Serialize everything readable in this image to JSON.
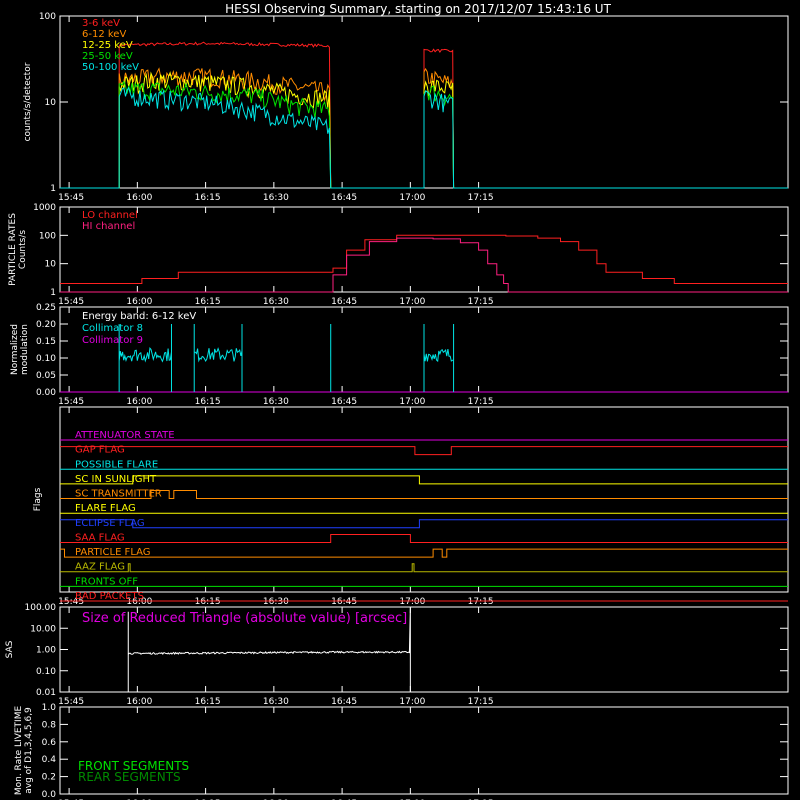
{
  "title": "HESSI Observing Summary, starting on 2017/12/07 15:43:16 UT",
  "time_axis": {
    "range_min": [
      -2,
      158
    ],
    "tick_labels": [
      "15:45",
      "16:00",
      "16:15",
      "16:30",
      "16:45",
      "17:00",
      "17:15"
    ],
    "tick_minutes": [
      0,
      15,
      30,
      45,
      60,
      75,
      90
    ]
  },
  "chart_data": [
    {
      "id": "counts",
      "type": "line",
      "ylabel": "counts/s/detector",
      "yscale": "log",
      "ylim": [
        1,
        100
      ],
      "yticks": [
        1,
        10,
        100
      ],
      "ytick_labels": [
        "1",
        "10",
        "100"
      ],
      "legend_placement": "top-left",
      "series": [
        {
          "name": "3-6 keV",
          "color": "#ff2020",
          "segments": [
            [
              [
                11,
                46
              ],
              [
                20,
                47
              ],
              [
                30,
                48
              ],
              [
                40,
                47
              ],
              [
                50,
                46
              ],
              [
                57.5,
                45
              ]
            ],
            [
              [
                78,
                40
              ],
              [
                84.5,
                39
              ]
            ]
          ]
        },
        {
          "name": "6-12 keV",
          "color": "#ff8c00",
          "segments": [
            [
              [
                11,
                18
              ],
              [
                20,
                20
              ],
              [
                30,
                20
              ],
              [
                40,
                18
              ],
              [
                50,
                15
              ],
              [
                57.5,
                13
              ]
            ],
            [
              [
                78,
                20
              ],
              [
                84.5,
                16
              ]
            ]
          ]
        },
        {
          "name": "12-25 keV",
          "color": "#ffff00",
          "segments": [
            [
              [
                11,
                16
              ],
              [
                20,
                18
              ],
              [
                30,
                17
              ],
              [
                40,
                15
              ],
              [
                50,
                12
              ],
              [
                57.5,
                11
              ]
            ],
            [
              [
                78,
                16
              ],
              [
                84.5,
                14
              ]
            ]
          ]
        },
        {
          "name": "25-50 keV",
          "color": "#00e000",
          "segments": [
            [
              [
                11,
                14
              ],
              [
                20,
                14
              ],
              [
                30,
                13
              ],
              [
                40,
                12
              ],
              [
                50,
                9
              ],
              [
                57.5,
                8
              ]
            ],
            [
              [
                78,
                14
              ],
              [
                84.5,
                11
              ]
            ]
          ]
        },
        {
          "name": "50-100 keV",
          "color": "#00e5e5",
          "segments": [
            [
              [
                11,
                12
              ],
              [
                20,
                11
              ],
              [
                30,
                10
              ],
              [
                40,
                8
              ],
              [
                50,
                6
              ],
              [
                57.5,
                5
              ]
            ],
            [
              [
                78,
                12
              ],
              [
                84.5,
                9
              ]
            ]
          ]
        }
      ]
    },
    {
      "id": "particle",
      "type": "line",
      "ylabel": "PARTICLE RATES\nCounts/s",
      "yscale": "log",
      "ylim": [
        1,
        1000
      ],
      "yticks": [
        1,
        10,
        100,
        1000
      ],
      "ytick_labels": [
        "1",
        "10",
        "100",
        "1000"
      ],
      "legend_placement": "top-left",
      "series": [
        {
          "name": "LO channel",
          "color": "#ff2020",
          "points": [
            [
              -2,
              2
            ],
            [
              12,
              2
            ],
            [
              16,
              3
            ],
            [
              20,
              3
            ],
            [
              24,
              5
            ],
            [
              40,
              5
            ],
            [
              50,
              5
            ],
            [
              56,
              5
            ],
            [
              58,
              7
            ],
            [
              61,
              30
            ],
            [
              65,
              70
            ],
            [
              72,
              100
            ],
            [
              80,
              100
            ],
            [
              92,
              100
            ],
            [
              96,
              95
            ],
            [
              103,
              80
            ],
            [
              108,
              60
            ],
            [
              112,
              30
            ],
            [
              116,
              10
            ],
            [
              118,
              5
            ],
            [
              122,
              5
            ],
            [
              126,
              3
            ],
            [
              130,
              3
            ],
            [
              133,
              2
            ],
            [
              158,
              2
            ]
          ]
        },
        {
          "name": "HI channel",
          "color": "#ff2080",
          "points": [
            [
              -2,
              1
            ],
            [
              56,
              1
            ],
            [
              58,
              4
            ],
            [
              61,
              20
            ],
            [
              66,
              60
            ],
            [
              72,
              80
            ],
            [
              80,
              75
            ],
            [
              86,
              55
            ],
            [
              90,
              30
            ],
            [
              92,
              10
            ],
            [
              94,
              4
            ],
            [
              95.5,
              2
            ],
            [
              96.5,
              1
            ],
            [
              158,
              1
            ]
          ]
        }
      ]
    },
    {
      "id": "modulation",
      "type": "line",
      "ylabel": "Normalized\nmodulation",
      "ylim": [
        0,
        0.25
      ],
      "yticks": [
        0,
        0.05,
        0.1,
        0.15,
        0.2,
        0.25
      ],
      "ytick_labels": [
        "0.00",
        "0.05",
        "0.10",
        "0.15",
        "0.20",
        "0.25"
      ],
      "annotation": "Energy band: 6-12 keV",
      "legend_placement": "top-left",
      "series": [
        {
          "name": "Collimator 8",
          "color": "#00e5e5",
          "segments": [
            [
              [
                11,
                0.11
              ],
              [
                22.5,
                0.11
              ]
            ],
            [
              [
                27.5,
                0.11
              ],
              [
                38,
                0.11
              ]
            ],
            [
              [
                57.5,
                0.11
              ],
              [
                57.5,
                0.11
              ]
            ],
            [
              [
                78,
                0.11
              ],
              [
                84.5,
                0.11
              ]
            ]
          ]
        },
        {
          "name": "Collimator 9",
          "color": "#e000e0",
          "points": [
            [
              -2,
              0
            ],
            [
              158,
              0
            ]
          ]
        }
      ]
    },
    {
      "id": "flags",
      "type": "step",
      "ylabel": "Flags",
      "rows": [
        {
          "name": "ATTENUATOR STATE",
          "color": "#e000e0",
          "steps": [
            [
              -2,
              0
            ],
            [
              158,
              0
            ]
          ]
        },
        {
          "name": "GAP FLAG",
          "color": "#ff2020",
          "steps": [
            [
              -2,
              1
            ],
            [
              76,
              1
            ],
            [
              76,
              0
            ],
            [
              84,
              0
            ],
            [
              84,
              1
            ],
            [
              158,
              1
            ]
          ]
        },
        {
          "name": "POSSIBLE FLARE",
          "color": "#00e5e5",
          "steps": [
            [
              -2,
              0
            ],
            [
              158,
              0
            ]
          ]
        },
        {
          "name": "SC IN SUNLIGHT",
          "color": "#ffff00",
          "steps": [
            [
              -2,
              0
            ],
            [
              14,
              0
            ],
            [
              14,
              1
            ],
            [
              77,
              1
            ],
            [
              77,
              0
            ],
            [
              158,
              0
            ]
          ]
        },
        {
          "name": "SC TRANSMITTER",
          "color": "#ff8c00",
          "steps": [
            [
              -2,
              0
            ],
            [
              18,
              0
            ],
            [
              18,
              1
            ],
            [
              22,
              1
            ],
            [
              22,
              0
            ],
            [
              23,
              0
            ],
            [
              23,
              1
            ],
            [
              28,
              1
            ],
            [
              28,
              0
            ],
            [
              158,
              0
            ]
          ]
        },
        {
          "name": "FLARE FLAG",
          "color": "#ffff00",
          "steps": [
            [
              -2,
              0
            ],
            [
              158,
              0
            ]
          ]
        },
        {
          "name": "ECLIPSE FLAG",
          "color": "#2040ff",
          "steps": [
            [
              -2,
              1
            ],
            [
              14,
              1
            ],
            [
              14,
              0
            ],
            [
              77,
              0
            ],
            [
              77,
              1
            ],
            [
              158,
              1
            ]
          ]
        },
        {
          "name": "SAA FLAG",
          "color": "#ff2020",
          "steps": [
            [
              -2,
              0
            ],
            [
              57.5,
              0
            ],
            [
              57.5,
              1
            ],
            [
              75,
              1
            ],
            [
              75,
              0
            ],
            [
              158,
              0
            ]
          ]
        },
        {
          "name": "PARTICLE FLAG",
          "color": "#ff8c00",
          "steps": [
            [
              -2,
              1
            ],
            [
              -1,
              1
            ],
            [
              -1,
              0
            ],
            [
              80,
              0
            ],
            [
              80,
              1
            ],
            [
              82,
              1
            ],
            [
              82,
              0
            ],
            [
              83,
              0
            ],
            [
              83,
              1
            ],
            [
              158,
              1
            ]
          ]
        },
        {
          "name": "AAZ FLAG",
          "color": "#b8b800",
          "steps": [
            [
              -2,
              0
            ],
            [
              13,
              0
            ],
            [
              13,
              1
            ],
            [
              13.4,
              1
            ],
            [
              13.4,
              0
            ],
            [
              75.4,
              0
            ],
            [
              75.4,
              1
            ],
            [
              75.8,
              1
            ],
            [
              75.8,
              0
            ],
            [
              158,
              0
            ]
          ]
        },
        {
          "name": "FRONTS OFF",
          "color": "#00e000",
          "steps": [
            [
              -2,
              0
            ],
            [
              158,
              0
            ]
          ]
        },
        {
          "name": "BAD PACKETS",
          "color": "#ff2020",
          "steps": [
            [
              -2,
              0
            ],
            [
              158,
              0
            ]
          ]
        }
      ]
    },
    {
      "id": "sas",
      "type": "line",
      "ylabel": "SAS",
      "yscale": "log",
      "ylim": [
        0.01,
        100
      ],
      "yticks": [
        0.01,
        0.1,
        1,
        10,
        100
      ],
      "ytick_labels": [
        "0.01",
        "0.10",
        "1.00",
        "10.00",
        "100.00"
      ],
      "annotation": "Size of Reduced Triangle (absolute value) [arcsec]",
      "series": [
        {
          "name": "SAS",
          "color": "#ffffff",
          "points": [
            [
              13,
              0.65
            ],
            [
              30,
              0.68
            ],
            [
              45,
              0.72
            ],
            [
              60,
              0.75
            ],
            [
              75,
              0.75
            ]
          ]
        }
      ]
    },
    {
      "id": "livetime",
      "type": "line",
      "ylabel": "Mon. Rate LIVETIME\navg of D1,3,4,5,6,9",
      "ylim": [
        0,
        1
      ],
      "yticks": [
        0,
        0.2,
        0.4,
        0.6,
        0.8,
        1.0
      ],
      "ytick_labels": [
        "0.0",
        "0.2",
        "0.4",
        "0.6",
        "0.8",
        "1.0"
      ],
      "legend_placement": "bottom-left",
      "series": [
        {
          "name": "FRONT SEGMENTS",
          "color": "#00e000",
          "points": []
        },
        {
          "name": "REAR SEGMENTS",
          "color": "#008a00",
          "points": []
        }
      ]
    }
  ]
}
